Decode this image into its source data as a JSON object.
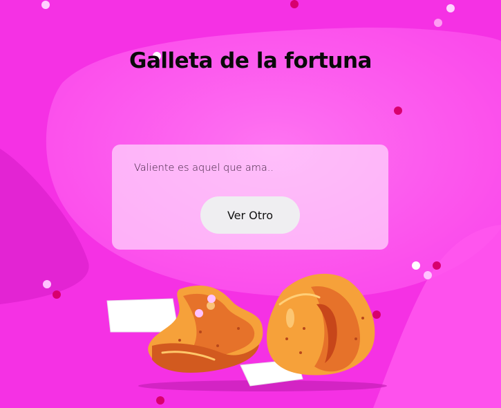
{
  "app": {
    "title": "Galleta de la fortuna"
  },
  "fortune": {
    "quote": "Valiente es aquel que ama..",
    "next_button_label": "Ver Otro"
  },
  "illustration": {
    "icon": "fortune-cookies-illustration"
  },
  "colors": {
    "background": "#f72fe6",
    "card": "#ffeaff",
    "button": "#efeef1",
    "cookie": "#f49a2b",
    "accent_dot": "#d8006e"
  }
}
